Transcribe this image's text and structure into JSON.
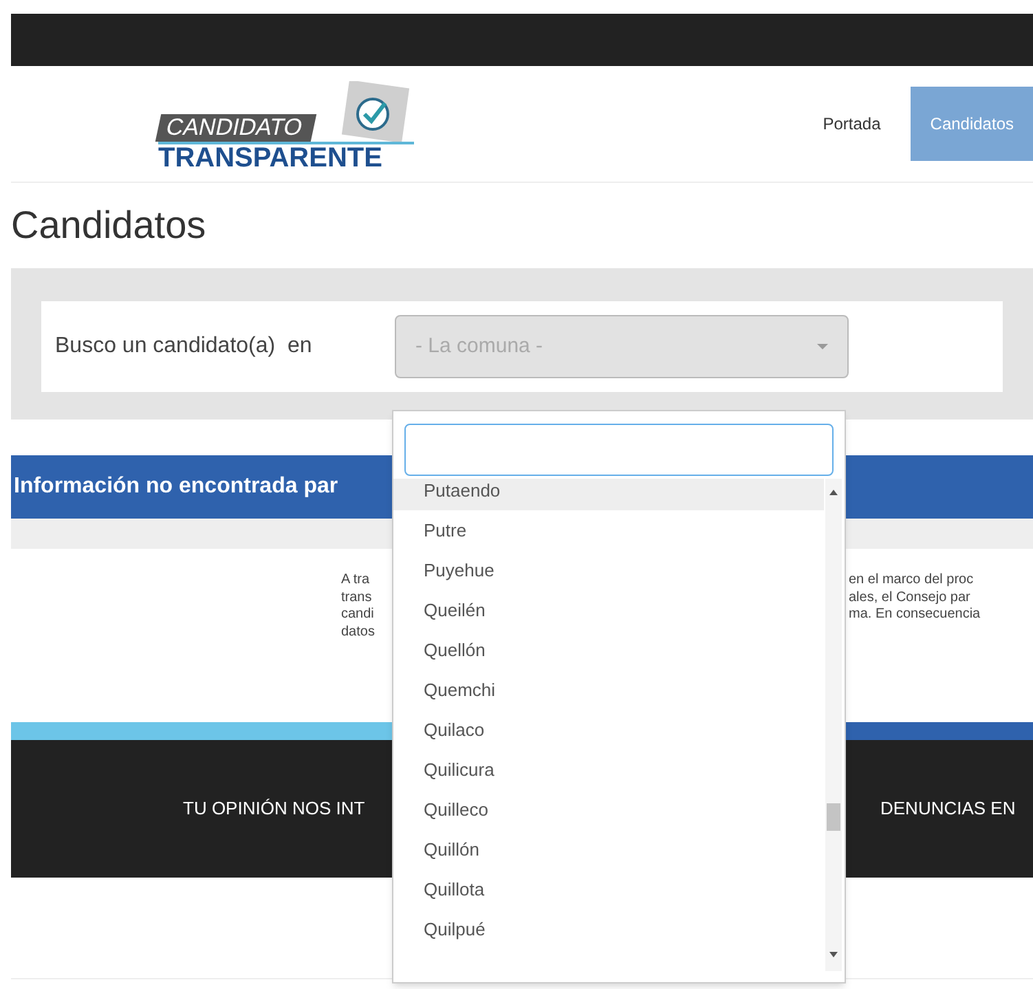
{
  "logo": {
    "line_1": "CANDIDATO",
    "line_2": "TRANSPARENTE"
  },
  "nav": [
    {
      "label": "Portada",
      "selected": false
    },
    {
      "label": "Candidatos",
      "selected": true
    }
  ],
  "page_title": "Candidatos",
  "search": {
    "label": "Busco un candidato(a)  en",
    "select_value": "- La comuna -"
  },
  "notice": "Información no encontrada par",
  "paragraph_left": [
    "A tra",
    "trans",
    "candi",
    "datos"
  ],
  "paragraph_right": [
    "en el marco del proc",
    "ales, el Consejo par",
    "ma. En consecuencia"
  ],
  "footer": [
    "TU OPINIÓN NOS INT",
    "DENUNCIAS EN"
  ],
  "dropdown": {
    "items": [
      {
        "label": "Putaendo",
        "highlighted": true
      },
      {
        "label": "Putre",
        "highlighted": false
      },
      {
        "label": "Puyehue",
        "highlighted": false
      },
      {
        "label": "Queilén",
        "highlighted": false
      },
      {
        "label": "Quellón",
        "highlighted": false
      },
      {
        "label": "Quemchi",
        "highlighted": false
      },
      {
        "label": "Quilaco",
        "highlighted": false
      },
      {
        "label": "Quilicura",
        "highlighted": false
      },
      {
        "label": "Quilleco",
        "highlighted": false
      },
      {
        "label": "Quillón",
        "highlighted": false
      },
      {
        "label": "Quillota",
        "highlighted": false
      },
      {
        "label": "Quilpué",
        "highlighted": false
      }
    ]
  }
}
